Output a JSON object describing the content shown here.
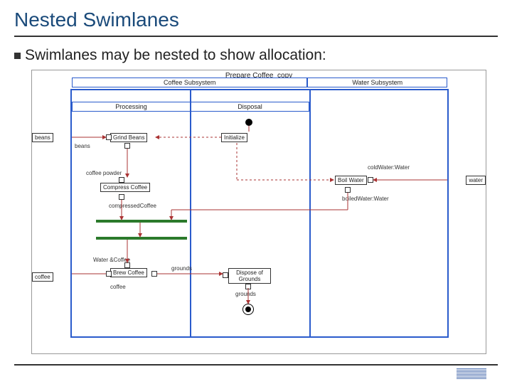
{
  "slide": {
    "title": "Nested Swimlanes",
    "bullet": "Swimlanes may be nested to show allocation:"
  },
  "diagram": {
    "frame_title": "Prepare Coffee_copy",
    "lanes": {
      "coffee_subsystem": "Coffee Subsystem",
      "water_subsystem": "Water Subsystem",
      "processing": "Processing",
      "disposal": "Disposal"
    },
    "pins": {
      "beans_in": "beans",
      "coffee_out": "coffee",
      "water_in": "water"
    },
    "activities": {
      "grind_beans": "Grind Beans",
      "initialize": "Initialize",
      "compress_coffee": "Compress Coffee",
      "boil_water": "Boil Water",
      "brew_coffee": "Brew Coffee",
      "dispose_grounds": "Dispose of Grounds"
    },
    "flow_labels": {
      "beans": "beans",
      "coffee_powder": "coffee powder",
      "compressed_coffee": "compressedCoffee",
      "cold_water": "coldWater:Water",
      "boiled_water": "boiledWater:Water",
      "water_coffee": "Water &Coffee",
      "coffee": "coffee",
      "grounds": "grounds",
      "grounds2": "grounds"
    }
  },
  "footer": {
    "page": ""
  }
}
